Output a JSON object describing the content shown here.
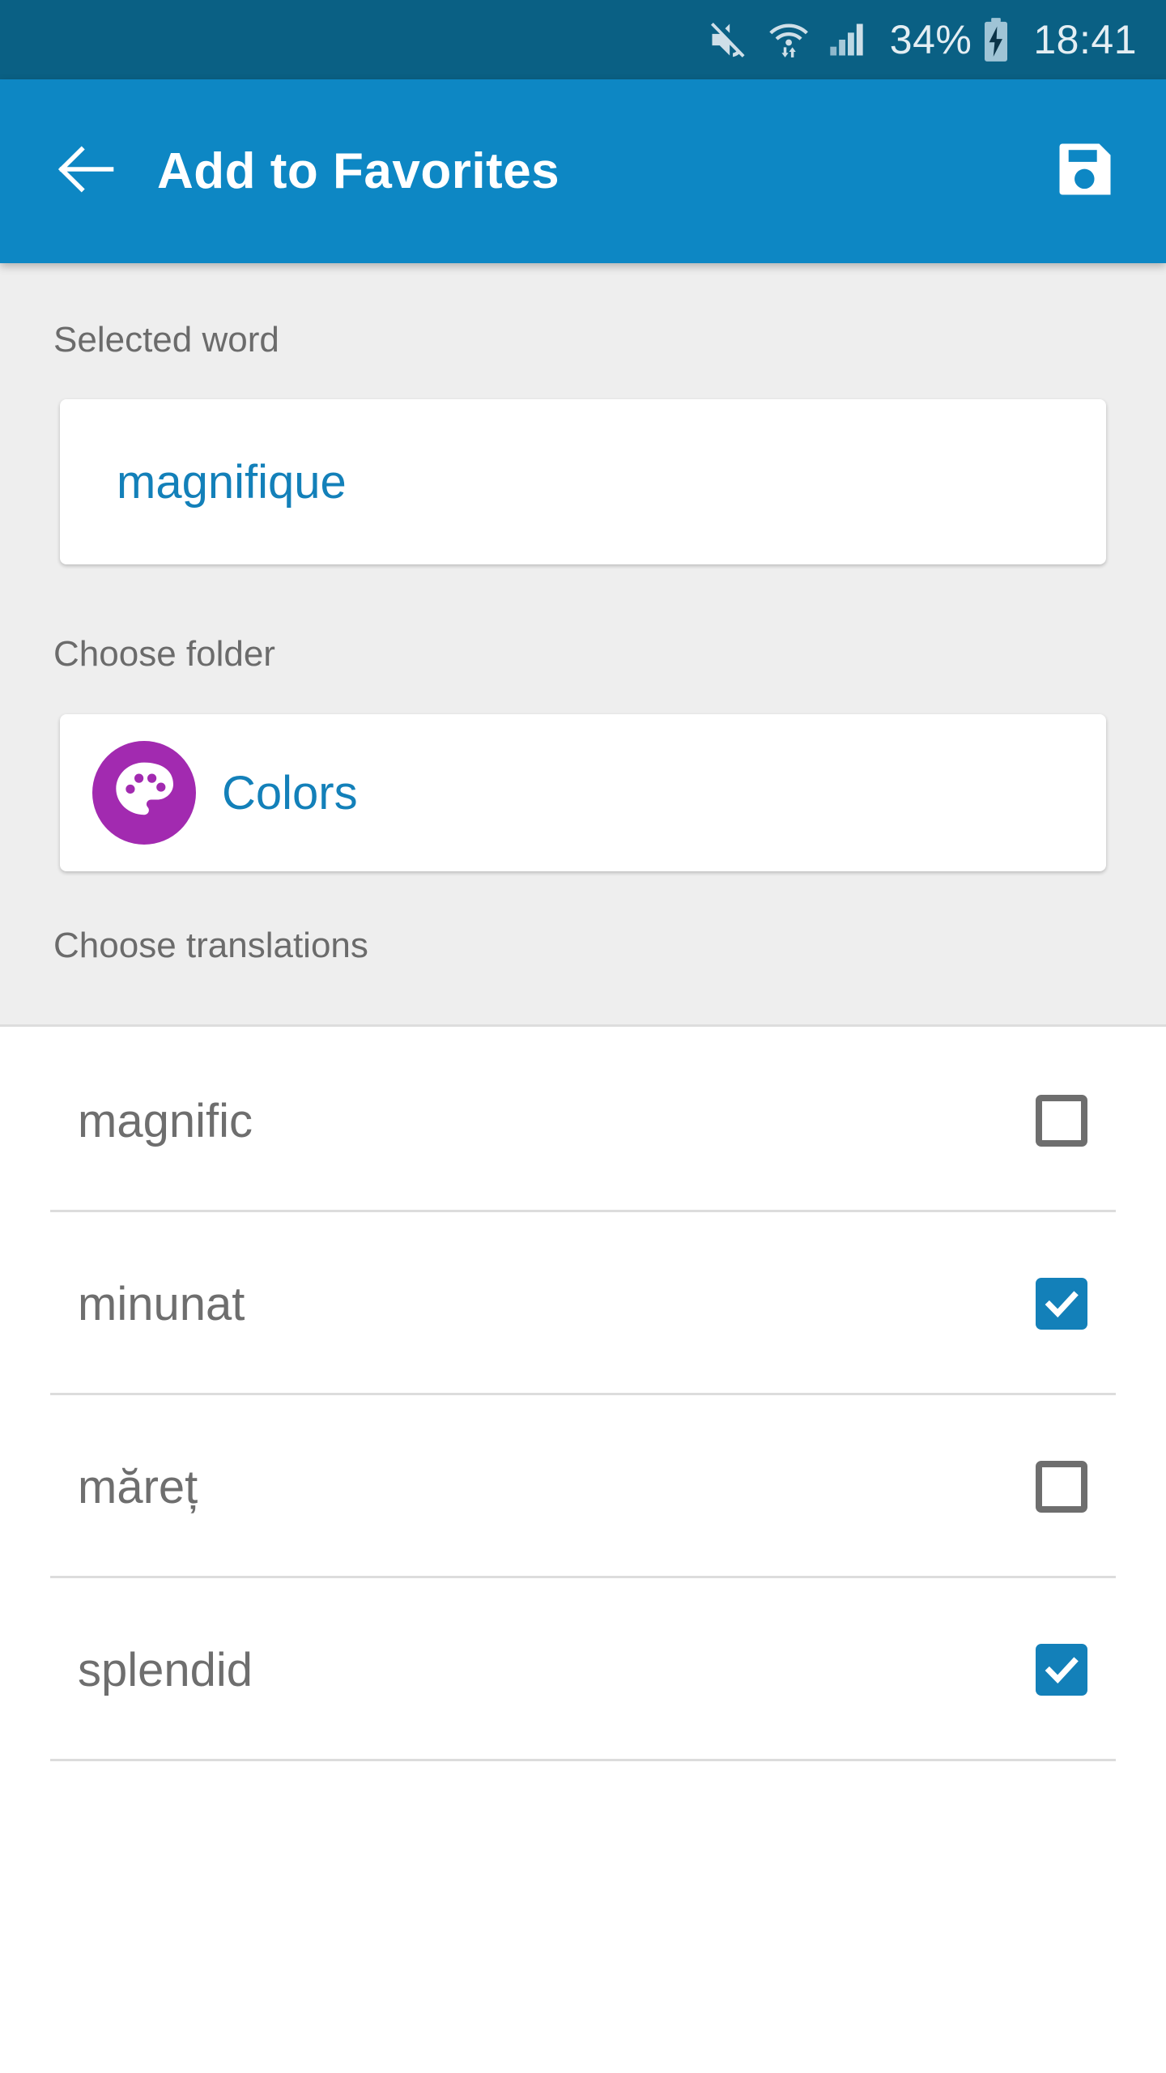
{
  "status_bar": {
    "icons": [
      "mute-icon",
      "wifi-icon",
      "signal-icon",
      "battery-charging-icon"
    ],
    "battery_percent": "34%",
    "clock": "18:41",
    "background_color": "#0a6084",
    "text_color": "#e4eef3"
  },
  "app_bar": {
    "title": "Add to Favorites",
    "back_icon": "back-arrow-icon",
    "save_icon": "save-floppy-icon",
    "background_color": "#0d87c4",
    "text_color": "#ffffff"
  },
  "form": {
    "selected_word_label": "Selected word",
    "selected_word_value": "magnifique",
    "choose_folder_label": "Choose folder",
    "folder_name": "Colors",
    "folder_icon": "palette-icon",
    "folder_icon_color": "#a22ab0",
    "choose_translations_label": "Choose translations",
    "accent_color": "#1380b9",
    "label_color": "#6b6b6b",
    "background_color": "#eeeeee"
  },
  "translations": [
    {
      "label": "magnific",
      "checked": false
    },
    {
      "label": "minunat",
      "checked": true
    },
    {
      "label": "măreț",
      "checked": false
    },
    {
      "label": "splendid",
      "checked": true
    }
  ]
}
